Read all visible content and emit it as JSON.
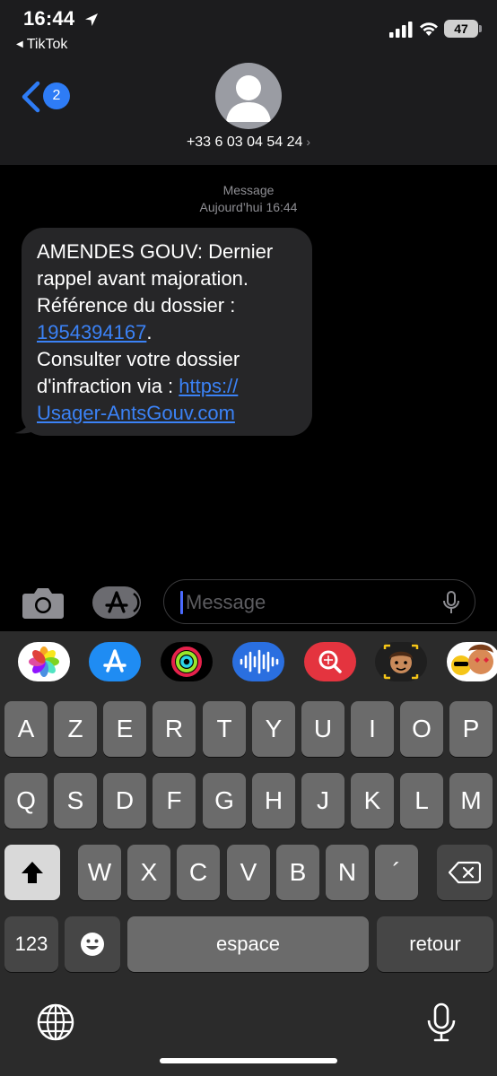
{
  "status_bar": {
    "time": "16:44",
    "back_app": "TikTok",
    "battery": "47"
  },
  "nav": {
    "back_badge": "2",
    "contact_number": "+33 6 03 04 54 24",
    "chevron": "›"
  },
  "conversation": {
    "service_label": "Message",
    "timestamp": "Aujourd’hui 16:44",
    "message": {
      "line1": "AMENDES GOUV: Dernier",
      "line2": "rappel avant majoration.",
      "line3": "Référence du dossier :",
      "reference": "1954394167",
      "reference_after": ".",
      "line5": "Consulter votre dossier",
      "line6_prefix": "d'infraction via : ",
      "link_part1": "https://",
      "link_part2": "Usager-AntsGouv.com"
    }
  },
  "input": {
    "placeholder": "Message"
  },
  "keyboard": {
    "row1": [
      "A",
      "Z",
      "E",
      "R",
      "T",
      "Y",
      "U",
      "I",
      "O",
      "P"
    ],
    "row2": [
      "Q",
      "S",
      "D",
      "F",
      "G",
      "H",
      "J",
      "K",
      "L",
      "M"
    ],
    "row3": [
      "W",
      "X",
      "C",
      "V",
      "B",
      "N",
      "´"
    ],
    "numbers_key": "123",
    "space_key": "espace",
    "return_key": "retour"
  },
  "app_strip": [
    "photos-app-icon",
    "app-store-app-icon",
    "activity-app-icon",
    "voice-memo-app-icon",
    "search-app-icon",
    "memoji-app-icon",
    "stickers-app-icon"
  ],
  "colors": {
    "accent_blue": "#2e7cf6",
    "link_blue": "#3b82f6",
    "bubble_gray": "#262628",
    "key_gray": "#6b6b6b"
  }
}
